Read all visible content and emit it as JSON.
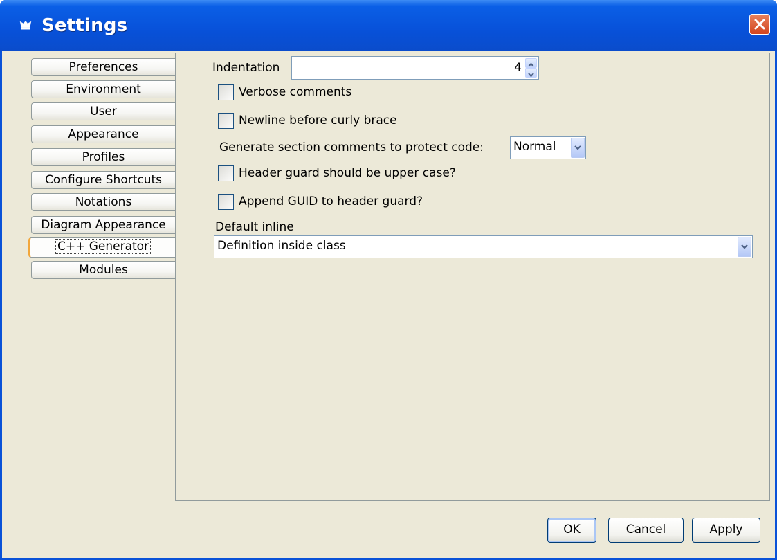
{
  "window": {
    "title": "Settings"
  },
  "tabs": [
    {
      "label": "Preferences"
    },
    {
      "label": "Environment"
    },
    {
      "label": "User"
    },
    {
      "label": "Appearance"
    },
    {
      "label": "Profiles"
    },
    {
      "label": "Configure Shortcuts"
    },
    {
      "label": "Notations"
    },
    {
      "label": "Diagram Appearance"
    },
    {
      "label": "C++ Generator",
      "selected": true
    },
    {
      "label": "Modules"
    }
  ],
  "panel": {
    "indentation_label": "Indentation",
    "indentation_value": "4",
    "verbose_comments": {
      "label": "Verbose comments",
      "checked": false
    },
    "newline_brace": {
      "label": "Newline before curly brace",
      "checked": false
    },
    "section_comments_label": "Generate section comments to protect code:",
    "section_comments_value": "Normal",
    "header_guard_upper": {
      "label": "Header guard should be upper case?",
      "checked": false
    },
    "append_guid": {
      "label": "Append GUID to header guard?",
      "checked": false
    },
    "default_inline_label": "Default inline",
    "default_inline_value": "Definition inside class"
  },
  "buttons": {
    "ok": {
      "mnemonic": "O",
      "rest": "K"
    },
    "cancel": {
      "mnemonic": "C",
      "rest": "ancel"
    },
    "apply": {
      "mnemonic": "A",
      "rest": "pply"
    }
  }
}
